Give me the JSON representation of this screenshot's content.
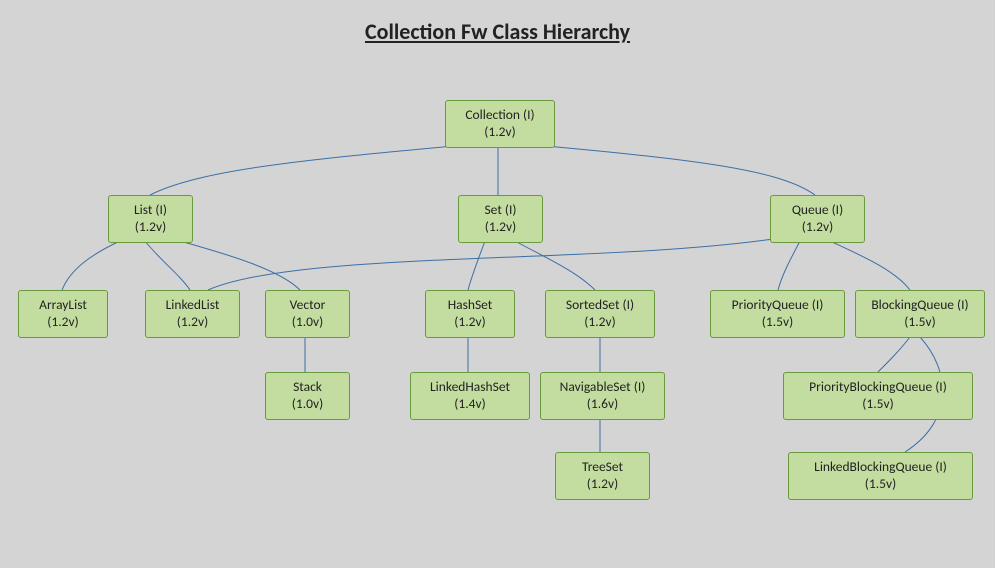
{
  "title": "Collection Fw Class Hierarchy",
  "nodes": {
    "collection": {
      "name": "Collection (I)",
      "version": "(1.2v)"
    },
    "list": {
      "name": "List (I)",
      "version": "(1.2v)"
    },
    "set": {
      "name": "Set (I)",
      "version": "(1.2v)"
    },
    "queue": {
      "name": "Queue (I)",
      "version": "(1.2v)"
    },
    "arraylist": {
      "name": "ArrayList",
      "version": "(1.2v)"
    },
    "linkedlist": {
      "name": "LinkedList",
      "version": "(1.2v)"
    },
    "vector": {
      "name": "Vector",
      "version": "(1.0v)"
    },
    "stack": {
      "name": "Stack",
      "version": "(1.0v)"
    },
    "hashset": {
      "name": "HashSet",
      "version": "(1.2v)"
    },
    "sortedset": {
      "name": "SortedSet (I)",
      "version": "(1.2v)"
    },
    "linkedhashset": {
      "name": "LinkedHashSet",
      "version": "(1.4v)"
    },
    "navigableset": {
      "name": "NavigableSet (I)",
      "version": "(1.6v)"
    },
    "treeset": {
      "name": "TreeSet",
      "version": "(1.2v)"
    },
    "priorityqueue": {
      "name": "PriorityQueue (I)",
      "version": "(1.5v)"
    },
    "blockingqueue": {
      "name": "BlockingQueue (I)",
      "version": "(1.5v)"
    },
    "priorityblockingqueue": {
      "name": "PriorityBlockingQueue (I)",
      "version": "(1.5v)"
    },
    "linkedblockingqueue": {
      "name": "LinkedBlockingQueue (I)",
      "version": "(1.5v)"
    }
  }
}
